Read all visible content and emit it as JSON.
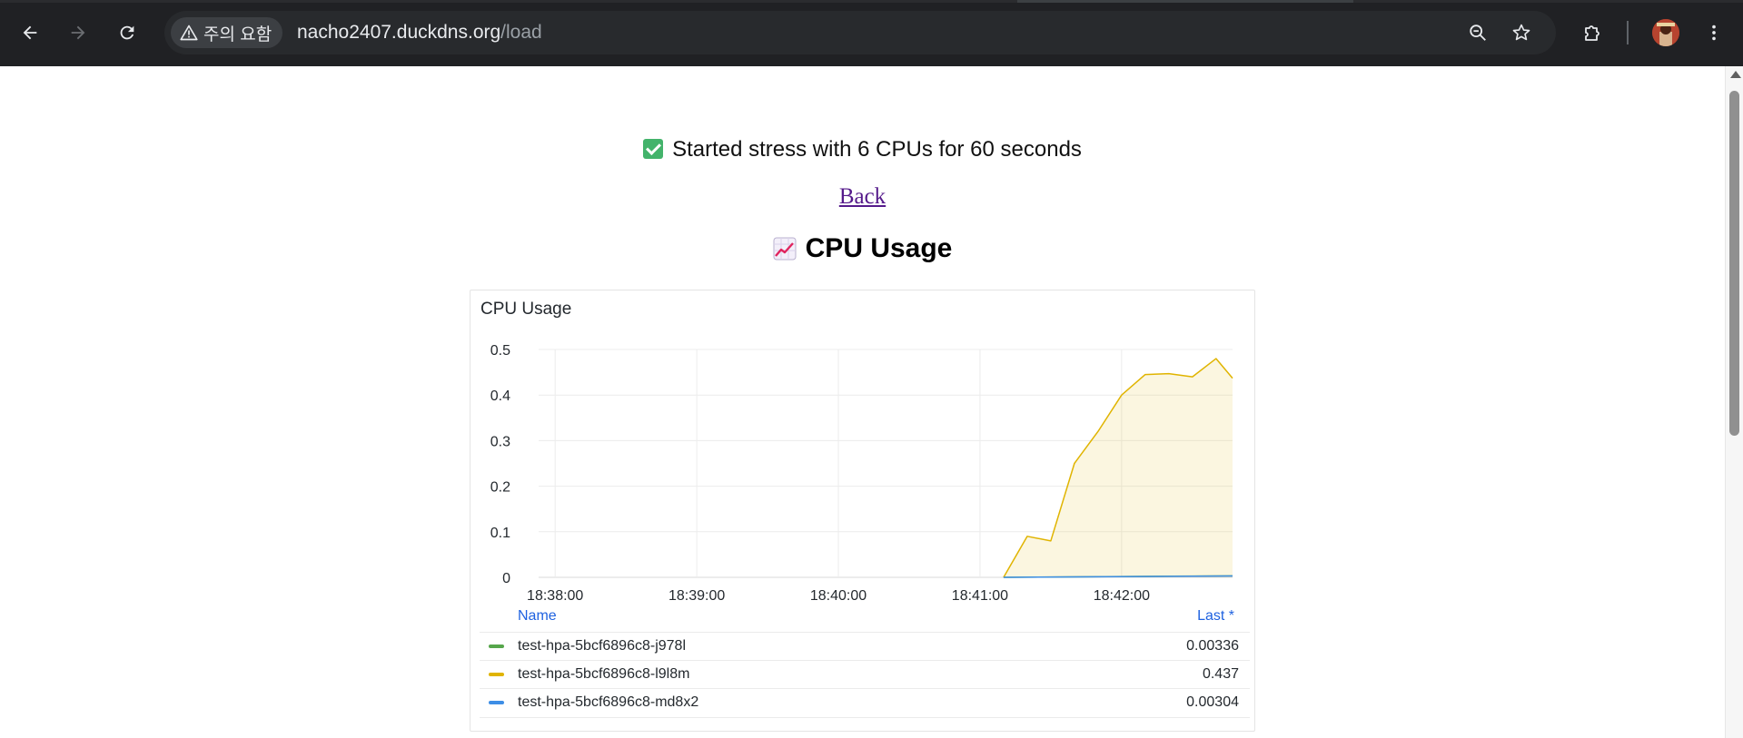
{
  "browser": {
    "security_chip_label": "주의 요함",
    "url_host": "nacho2407.duckdns.org",
    "url_path": "/load"
  },
  "page": {
    "status_message": "Started stress with 6 CPUs for 60 seconds",
    "back_link": "Back",
    "heading": "CPU Usage",
    "icons": {
      "status": "check-mark-button-icon",
      "heading": "chart-increasing-icon"
    }
  },
  "panel": {
    "title": "CPU Usage",
    "legend_headers": {
      "name": "Name",
      "last": "Last *"
    },
    "legend": [
      {
        "name": "test-hpa-5bcf6896c8-j978l",
        "last": "0.00336",
        "color": "#56a64b"
      },
      {
        "name": "test-hpa-5bcf6896c8-l9l8m",
        "last": "0.437",
        "color": "#e0b400"
      },
      {
        "name": "test-hpa-5bcf6896c8-md8x2",
        "last": "0.00304",
        "color": "#3d8ee6"
      }
    ]
  },
  "chart_data": {
    "type": "area",
    "title": "CPU Usage",
    "x_ticks": [
      "18:38:00",
      "18:39:00",
      "18:40:00",
      "18:41:00",
      "18:42:00"
    ],
    "y_ticks": [
      0,
      0.1,
      0.2,
      0.3,
      0.4,
      0.5
    ],
    "xlim": [
      "18:37:53",
      "18:42:47"
    ],
    "ylim": [
      0,
      0.5
    ],
    "grid": true,
    "legend": "bottom",
    "series": [
      {
        "name": "test-hpa-5bcf6896c8-j978l",
        "color": "#56a64b",
        "points": [
          [
            "18:41:10",
            0.0
          ],
          [
            "18:42:47",
            0.00336
          ]
        ]
      },
      {
        "name": "test-hpa-5bcf6896c8-l9l8m",
        "color": "#e0b400",
        "fill": true,
        "points": [
          [
            "18:41:10",
            0.0
          ],
          [
            "18:41:20",
            0.09
          ],
          [
            "18:41:30",
            0.08
          ],
          [
            "18:41:40",
            0.25
          ],
          [
            "18:41:50",
            0.32
          ],
          [
            "18:42:00",
            0.4
          ],
          [
            "18:42:10",
            0.445
          ],
          [
            "18:42:20",
            0.447
          ],
          [
            "18:42:30",
            0.44
          ],
          [
            "18:42:40",
            0.48
          ],
          [
            "18:42:47",
            0.437
          ]
        ]
      },
      {
        "name": "test-hpa-5bcf6896c8-md8x2",
        "color": "#3d8ee6",
        "points": [
          [
            "18:41:10",
            0.0
          ],
          [
            "18:42:47",
            0.00304
          ]
        ]
      }
    ]
  }
}
